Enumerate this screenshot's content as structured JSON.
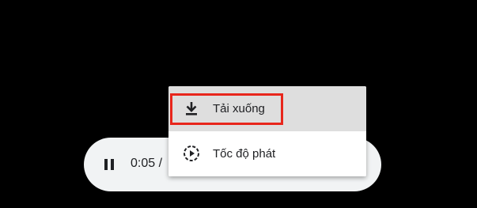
{
  "player": {
    "time_display": "0:05 /",
    "state": "playing"
  },
  "menu": {
    "items": [
      {
        "label": "Tải xuống",
        "icon": "download-icon"
      },
      {
        "label": "Tốc độ phát",
        "icon": "playback-speed-icon"
      }
    ]
  },
  "colors": {
    "background": "#000000",
    "player_bar": "#f1f3f4",
    "menu_hover": "#dedede",
    "highlight": "#e8261c"
  }
}
